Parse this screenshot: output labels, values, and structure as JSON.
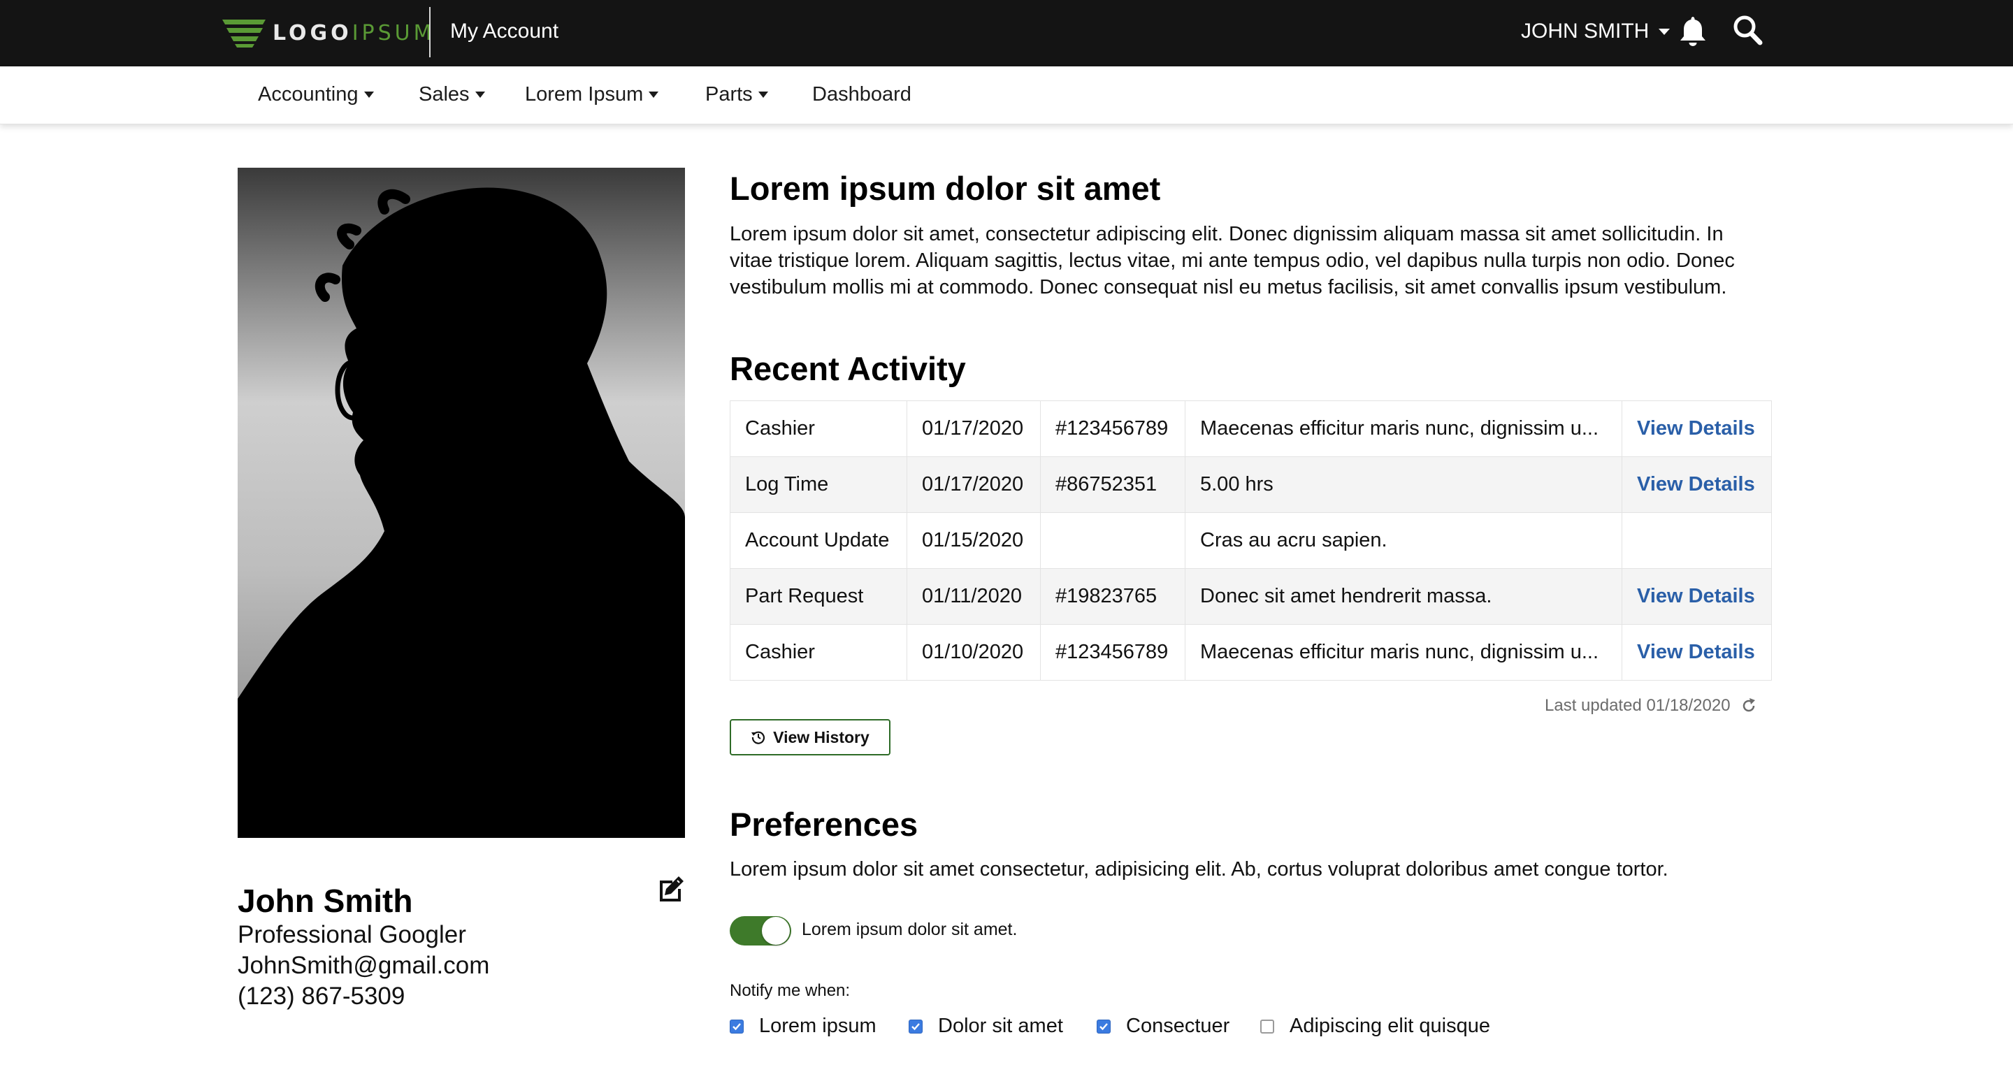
{
  "header": {
    "logo_main": "LOGO",
    "logo_accent": "IPSUM",
    "title": "My Account",
    "user_name": "JOHN SMITH"
  },
  "nav": [
    {
      "label": "Accounting",
      "has_dropdown": true
    },
    {
      "label": "Sales",
      "has_dropdown": true
    },
    {
      "label": "Lorem Ipsum",
      "has_dropdown": true
    },
    {
      "label": "Parts",
      "has_dropdown": true
    },
    {
      "label": "Dashboard",
      "has_dropdown": false
    }
  ],
  "profile": {
    "name": "John Smith",
    "title": "Professional Googler",
    "email": "JohnSmith@gmail.com",
    "phone": "(123) 867-5309"
  },
  "intro": {
    "heading": "Lorem ipsum dolor sit amet",
    "text": "Lorem ipsum dolor sit amet, consectetur adipiscing elit. Donec dignissim aliquam massa sit amet sollicitudin. In vitae tristique lorem. Aliquam sagittis, lectus vitae, mi ante tempus odio, vel dapibus nulla turpis non odio. Donec vestibulum mollis mi at commodo. Donec consequat nisl eu metus facilisis, sit amet convallis ipsum vestibulum."
  },
  "activity": {
    "heading": "Recent Activity",
    "rows": [
      {
        "type": "Cashier",
        "date": "01/17/2020",
        "ref": "#123456789",
        "desc": "Maecenas efficitur maris nunc, dignissim u...",
        "link": "View Details"
      },
      {
        "type": "Log Time",
        "date": "01/17/2020",
        "ref": "#86752351",
        "desc": "5.00 hrs",
        "link": "View Details"
      },
      {
        "type": "Account Update",
        "date": "01/15/2020",
        "ref": "",
        "desc": "Cras au acru sapien.",
        "link": ""
      },
      {
        "type": "Part Request",
        "date": "01/11/2020",
        "ref": "#19823765",
        "desc": "Donec sit amet hendrerit massa.",
        "link": "View Details"
      },
      {
        "type": "Cashier",
        "date": "01/10/2020",
        "ref": "#123456789",
        "desc": "Maecenas efficitur maris nunc, dignissim u...",
        "link": "View Details"
      }
    ],
    "last_updated": "Last updated 01/18/2020",
    "history_button": "View History"
  },
  "preferences": {
    "heading": "Preferences",
    "description": "Lorem ipsum dolor sit amet consectetur, adipisicing elit. Ab, cortus voluprat doloribus amet congue tortor.",
    "toggle_label": "Lorem ipsum dolor sit amet.",
    "toggle_on": true,
    "notify_label": "Notify me when:",
    "options": [
      {
        "label": "Lorem ipsum",
        "checked": true
      },
      {
        "label": "Dolor sit amet",
        "checked": true
      },
      {
        "label": "Consectuer",
        "checked": true
      },
      {
        "label": "Adipiscing elit quisque",
        "checked": false
      }
    ]
  },
  "colors": {
    "topbar": "#141414",
    "brand_green": "#3e7a2a",
    "link_blue": "#2a5fa8",
    "checkbox_blue": "#3b7be0"
  },
  "icons": [
    "bell-icon",
    "search-icon",
    "edit-icon",
    "history-icon",
    "refresh-icon",
    "check-icon",
    "caret-down-icon"
  ]
}
